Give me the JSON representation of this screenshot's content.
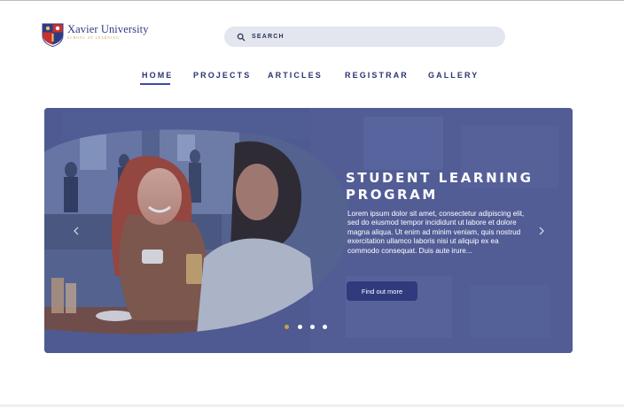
{
  "brand": {
    "name": "Xavier University",
    "tagline": "SCHOOL OF LEARNING",
    "colors": {
      "navy": "#2f3a84",
      "gold": "#c99a35",
      "red": "#c8322e"
    }
  },
  "search": {
    "label": "SEARCH",
    "icon": "search-icon"
  },
  "nav": {
    "items": [
      {
        "label": "HOME",
        "active": true
      },
      {
        "label": "PROJECTS",
        "active": false
      },
      {
        "label": "ARTICLES",
        "active": false
      },
      {
        "label": "REGISTRAR",
        "active": false
      },
      {
        "label": "GALLERY",
        "active": false
      }
    ]
  },
  "hero": {
    "title_line1": "STUDENT LEARNING",
    "title_line2": "PROGRAM",
    "body": "Lorem ipsum dolor sit amet, consectetur adipiscing elit, sed do eiusmod tempor incididunt ut labore et dolore magna aliqua. Ut enim ad minim veniam, quis nostrud exercitation ullamco laboris nisi ut aliquip ex ea commodo consequat. Duis aute irure...",
    "cta_label": "Find out more",
    "prev_icon": "chevron-left-icon",
    "next_icon": "chevron-right-icon",
    "slides": {
      "count": 4,
      "active_index": 0
    },
    "colors": {
      "overlay": "#4f5b92",
      "button": "#2f3b7c",
      "active_dot": "#c9a24a",
      "dot": "#ffffff"
    }
  }
}
